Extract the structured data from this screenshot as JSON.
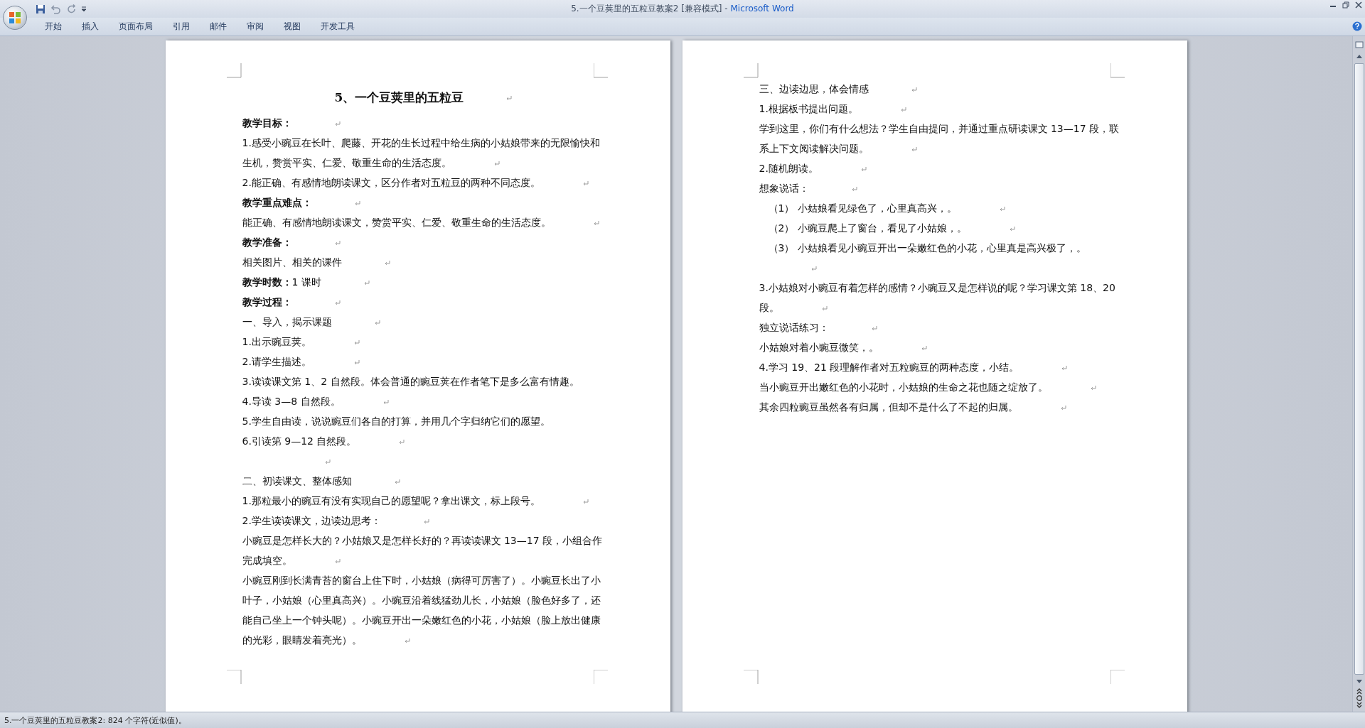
{
  "window": {
    "document_title": "5.一个豆荚里的五粒豆教案2 [兼容模式]",
    "separator": " - ",
    "app_name": "Microsoft Word"
  },
  "ribbon_tabs": [
    {
      "label": "开始"
    },
    {
      "label": "插入"
    },
    {
      "label": "页面布局"
    },
    {
      "label": "引用"
    },
    {
      "label": "邮件"
    },
    {
      "label": "审阅"
    },
    {
      "label": "视图"
    },
    {
      "label": "开发工具"
    }
  ],
  "pages": [
    {
      "title": "5、一个豆荚里的五粒豆",
      "paragraphs": [
        {
          "kind": "heading",
          "text": "教学目标：",
          "mark": true
        },
        {
          "kind": "text",
          "text": "1.感受小豌豆在长叶、爬藤、开花的生长过程中给生病的小姑娘带来的无限愉快和生机，赞赏平实、仁爱、敬重生命的生活态度。",
          "mark": true
        },
        {
          "kind": "text",
          "text": "2.能正确、有感情地朗读课文，区分作者对五粒豆的两种不同态度。",
          "mark": true
        },
        {
          "kind": "heading",
          "text": "教学重点难点：",
          "mark": true
        },
        {
          "kind": "text",
          "text": "能正确、有感情地朗读课文，赞赏平实、仁爱、敬重生命的生活态度。",
          "mark": true
        },
        {
          "kind": "heading",
          "text": "教学准备：",
          "mark": true
        },
        {
          "kind": "text",
          "text": "相关图片、相关的课件",
          "mark": true
        },
        {
          "kind": "text",
          "text": "**教学时数：**1 课时",
          "mark": true
        },
        {
          "kind": "heading",
          "text": "教学过程：",
          "mark": true
        },
        {
          "kind": "text",
          "text": "一、导入，揭示课题",
          "mark": true
        },
        {
          "kind": "text",
          "text": "1.出示豌豆荚。",
          "mark": true
        },
        {
          "kind": "text",
          "text": "2.请学生描述。",
          "mark": true
        },
        {
          "kind": "text",
          "text": "3.读读课文第 1、2 自然段。体会普通的豌豆荚在作者笔下是多么富有情趣。",
          "mark": false
        },
        {
          "kind": "text",
          "text": "4.导读 3—8 自然段。",
          "mark": true
        },
        {
          "kind": "text",
          "text": "5.学生自由读，说说豌豆们各自的打算，并用几个字归纳它们的愿望。",
          "mark": false
        },
        {
          "kind": "text",
          "text": "6.引读第 9—12 自然段。",
          "mark": true
        },
        {
          "kind": "blank",
          "mark": true
        },
        {
          "kind": "text",
          "text": "二、初读课文、整体感知",
          "mark": true
        },
        {
          "kind": "text",
          "text": "1.那粒最小的豌豆有没有实现自己的愿望呢？拿出课文，标上段号。",
          "mark": true
        },
        {
          "kind": "text",
          "text": "2.学生读读课文，边读边思考：",
          "mark": true
        },
        {
          "kind": "text",
          "text": "小豌豆是怎样长大的？小姑娘又是怎样长好的？再读读课文 13—17 段，小组合作完成填空。",
          "mark": true
        },
        {
          "kind": "text",
          "text": "小豌豆刚到长满青苔的窗台上住下时，小姑娘（病得可厉害了）。小豌豆长出了小叶子，小姑娘（心里真高兴）。小豌豆沿着线猛劲儿长，小姑娘（脸色好多了，还能自己坐上一个钟头呢）。小豌豆开出一朵嫩红色的小花，小姑娘（脸上放出健康的光彩，眼睛发着亮光）。",
          "mark": true
        }
      ]
    },
    {
      "paragraphs": [
        {
          "kind": "text",
          "text": "三、边读边思，体会情感",
          "mark": true
        },
        {
          "kind": "text",
          "text": "1.根据板书提出问题。",
          "mark": true
        },
        {
          "kind": "text",
          "text": "学到这里，你们有什么想法？学生自由提问，并通过重点研读课文 13—17 段，联系上下文阅读解决问题。",
          "mark": true
        },
        {
          "kind": "text",
          "text": "2.随机朗读。",
          "mark": true
        },
        {
          "kind": "text",
          "text": "想象说话：",
          "mark": true
        },
        {
          "kind": "item",
          "text": "（1） 小姑娘看见绿色了，心里真高兴，。",
          "mark": true
        },
        {
          "kind": "item",
          "text": "（2） 小豌豆爬上了窗台，看见了小姑娘，。",
          "mark": true
        },
        {
          "kind": "item",
          "text": "（3） 小姑娘看见小豌豆开出一朵嫩红色的小花，心里真是高兴极了，。",
          "mark": true
        },
        {
          "kind": "text",
          "text": "3.小姑娘对小豌豆有着怎样的感情？小豌豆又是怎样说的呢？学习课文第 18、20 段。",
          "mark": true
        },
        {
          "kind": "text",
          "text": "独立说话练习：",
          "mark": true
        },
        {
          "kind": "text",
          "text": "小姑娘对着小豌豆微笑，。",
          "mark": true
        },
        {
          "kind": "text",
          "text": "4.学习 19、21 段理解作者对五粒豌豆的两种态度，小结。",
          "mark": true
        },
        {
          "kind": "text",
          "text": "当小豌豆开出嫩红色的小花时，小姑娘的生命之花也随之绽放了。",
          "mark": true
        },
        {
          "kind": "text",
          "text": "其余四粒豌豆虽然各有归属，但却不是什么了不起的归属。",
          "mark": true
        }
      ]
    }
  ],
  "status_bar": {
    "text": "5.一个豆荚里的五粒豆教案2: 824 个字符(近似值)。"
  }
}
